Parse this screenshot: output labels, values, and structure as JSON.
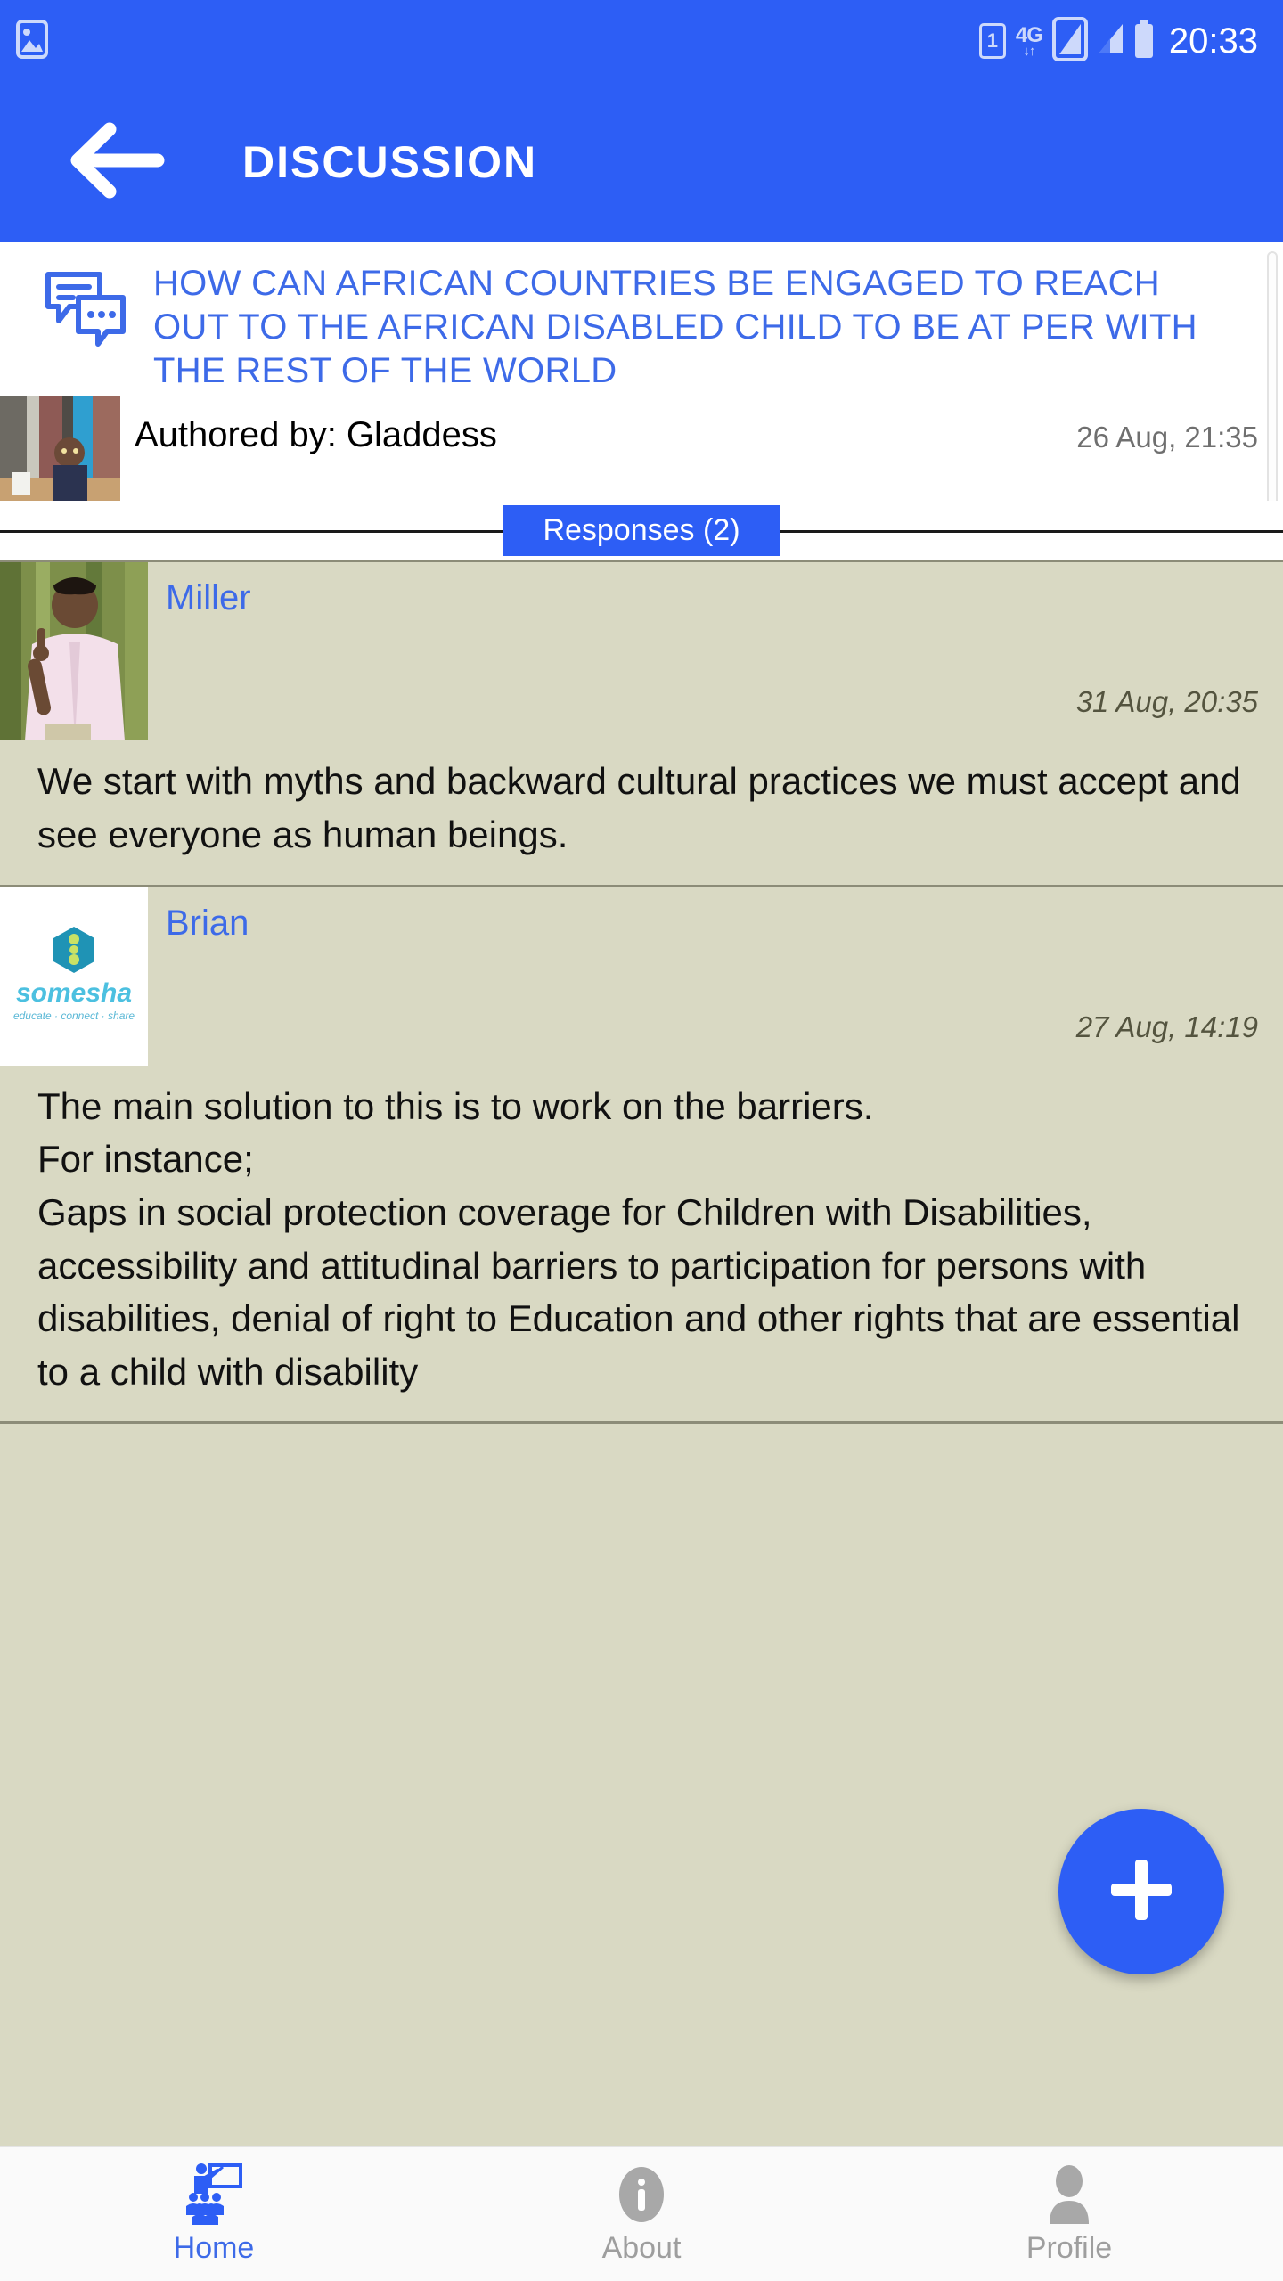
{
  "status_bar": {
    "time": "20:33",
    "sim_label": "1",
    "network_label": "4G",
    "network_arrows": "↓↑",
    "icons": [
      "image-icon",
      "sim-card-icon",
      "network-4g-icon",
      "signal-bar-icon",
      "signal-bar-secondary-icon",
      "battery-icon"
    ]
  },
  "app_bar": {
    "title": "DISCUSSION",
    "back_icon": "arrow-left-icon"
  },
  "topic": {
    "icon": "chat-bubbles-icon",
    "title": "HOW CAN AFRICAN COUNTRIES BE ENGAGED TO REACH OUT TO THE AFRICAN DISABLED CHILD TO BE AT PER WITH THE REST OF THE WORLD",
    "author_label": "Authored by: Gladdess",
    "date": "26 Aug, 21:35",
    "thumbnail": "topic-photo-thumbnail"
  },
  "responses_tab": {
    "label": "Responses (2)",
    "count": 2
  },
  "responses": [
    {
      "user": "Miller",
      "date": "31 Aug, 20:35",
      "avatar_type": "photo",
      "avatar_name": "miller-avatar-photo",
      "body": "We start with myths and backward cultural practices we must accept and see everyone as human beings."
    },
    {
      "user": "Brian",
      "date": "27 Aug, 14:19",
      "avatar_type": "logo",
      "avatar_name": "somesha-logo-avatar",
      "logo_text": "somesha",
      "logo_tagline": "educate · connect · share",
      "body": "The main solution to this is to work on the barriers.\nFor instance;\nGaps in social protection coverage for Children with Disabilities, accessibility and attitudinal barriers to participation for persons with disabilities, denial of right to Education and other rights that are essential to a child with disability"
    }
  ],
  "fab": {
    "icon": "plus-icon",
    "label": "+"
  },
  "bottom_nav": {
    "items": [
      {
        "label": "Home",
        "icon": "classroom-teacher-icon",
        "active": true
      },
      {
        "label": "About",
        "icon": "info-circle-icon",
        "active": false
      },
      {
        "label": "Profile",
        "icon": "person-icon",
        "active": false
      }
    ]
  },
  "colors": {
    "primary_blue": "#2d5ef5",
    "link_blue": "#3d6ae8",
    "body_background": "#d9d9c3",
    "card_background": "#ffffff",
    "nav_inactive": "#9e9e9e",
    "date_text": "#54543f",
    "logo_teal": "#27a3bd"
  }
}
